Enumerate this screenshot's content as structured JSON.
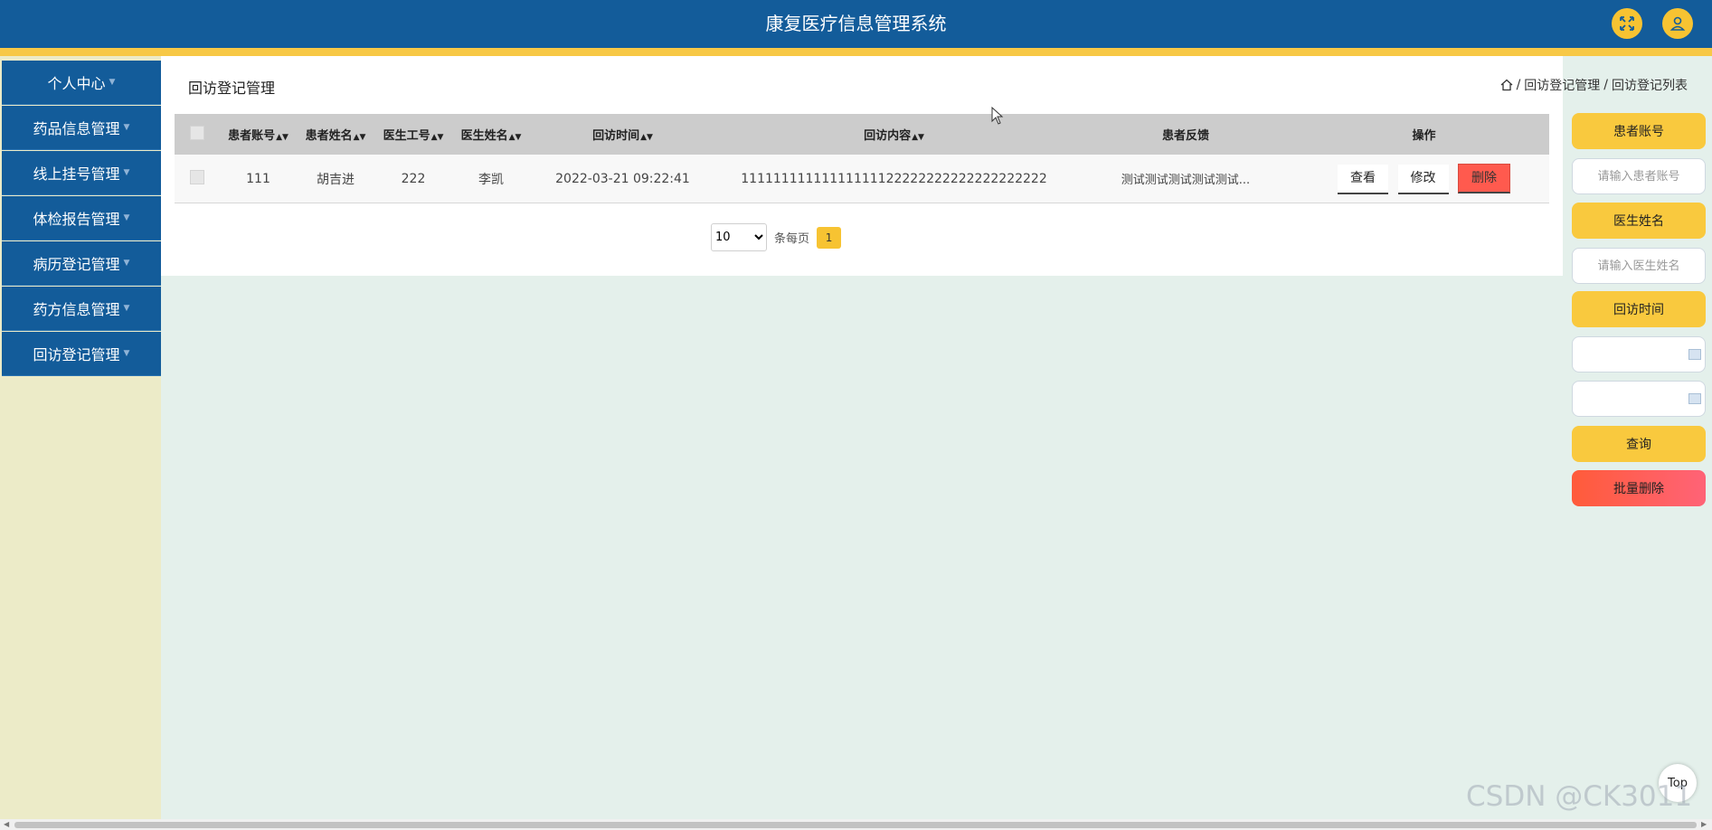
{
  "header": {
    "title": "康复医疗信息管理系统",
    "fullscreen_icon": "expand-arrows-icon",
    "user_icon": "user-icon",
    "colors": {
      "bar": "#135c9a",
      "accent": "#f7c332"
    }
  },
  "sidebar": {
    "items": [
      {
        "label": "个人中心"
      },
      {
        "label": "药品信息管理"
      },
      {
        "label": "线上挂号管理"
      },
      {
        "label": "体检报告管理"
      },
      {
        "label": "病历登记管理"
      },
      {
        "label": "药方信息管理"
      },
      {
        "label": "回访登记管理"
      }
    ]
  },
  "page": {
    "title": "回访登记管理",
    "breadcrumb": [
      "回访登记管理",
      "回访登记列表"
    ],
    "home_icon": "home-icon"
  },
  "table": {
    "headers": [
      "患者账号",
      "患者姓名",
      "医生工号",
      "医生姓名",
      "回访时间",
      "回访内容",
      "患者反馈",
      "操作"
    ],
    "rows": [
      {
        "patient_account": "111",
        "patient_name": "胡吉进",
        "doctor_id": "222",
        "doctor_name": "李凯",
        "visit_time": "2022-03-21 09:22:41",
        "visit_content": "11111111111111111122222222222222222222",
        "feedback": "测试测试测试测试测试...",
        "actions": {
          "view": "查看",
          "edit": "修改",
          "delete": "删除"
        }
      }
    ]
  },
  "pagination": {
    "page_size": "10",
    "page_size_options": [
      "10"
    ],
    "per_page_label": "条每页",
    "current_page": "1"
  },
  "search_panel": {
    "patient_account_label": "患者账号",
    "patient_account_placeholder": "请输入患者账号",
    "doctor_name_label": "医生姓名",
    "doctor_name_placeholder": "请输入医生姓名",
    "visit_time_label": "回访时间",
    "query_button": "查询",
    "batch_delete_button": "批量删除"
  },
  "misc": {
    "top_button": "Top",
    "watermark": "CSDN @CK3011"
  }
}
